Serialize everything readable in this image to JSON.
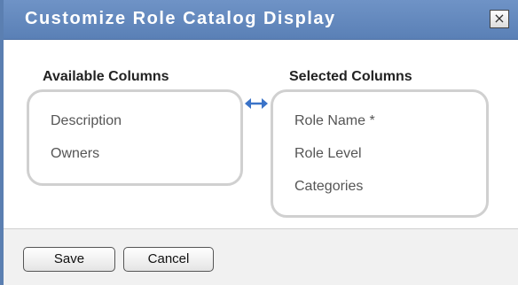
{
  "dialog": {
    "title": "Customize Role Catalog Display",
    "close_label": "×"
  },
  "available": {
    "heading": "Available Columns",
    "items": [
      "Description",
      "Owners"
    ]
  },
  "selected": {
    "heading": "Selected Columns",
    "items": [
      "Role Name *",
      "Role Level",
      "Categories"
    ]
  },
  "icons": {
    "swap": "double-arrow-icon",
    "close": "close-icon"
  },
  "footer": {
    "save_label": "Save",
    "cancel_label": "Cancel"
  },
  "colors": {
    "title_bar": "#6285bb",
    "accent_arrow": "#3a73c8",
    "box_border": "#d0d0d0"
  }
}
